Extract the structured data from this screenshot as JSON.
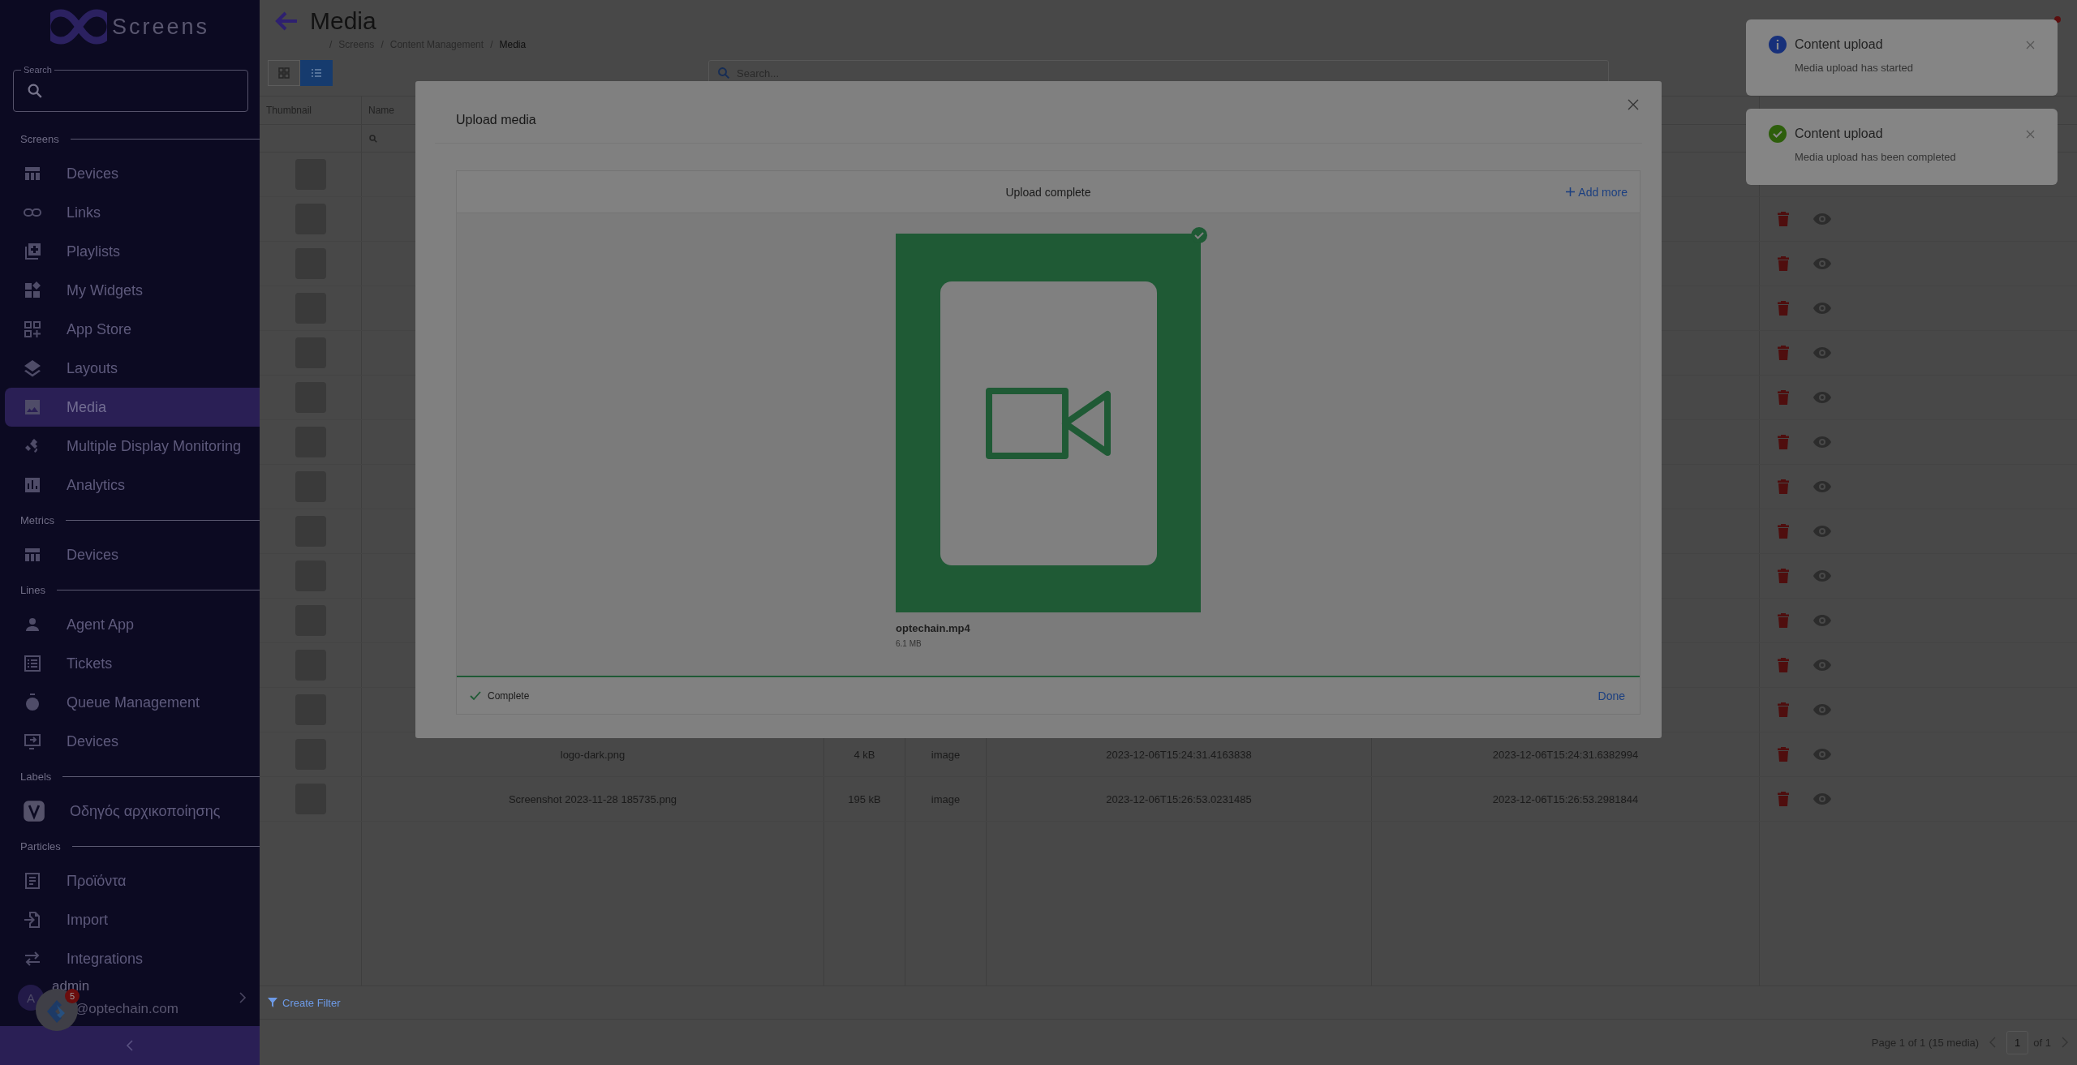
{
  "sidebar": {
    "logo": "Screens",
    "search_label": "Search",
    "sections": [
      {
        "title": "Screens",
        "items": [
          {
            "label": "Devices",
            "kind": "table",
            "selected": false
          },
          {
            "label": "Links",
            "kind": "link",
            "selected": false
          },
          {
            "label": "Playlists",
            "kind": "playlist",
            "selected": false
          },
          {
            "label": "My Widgets",
            "kind": "widgets",
            "selected": false
          },
          {
            "label": "App Store",
            "kind": "apps",
            "selected": false
          },
          {
            "label": "Layouts",
            "kind": "layers",
            "selected": false
          },
          {
            "label": "Media",
            "kind": "image",
            "selected": true
          },
          {
            "label": "Multiple Display Monitoring",
            "kind": "satellite",
            "selected": false
          },
          {
            "label": "Analytics",
            "kind": "chart",
            "selected": false
          }
        ]
      },
      {
        "title": "Metrics",
        "items": [
          {
            "label": "Devices",
            "kind": "table",
            "selected": false
          }
        ]
      },
      {
        "title": "Lines",
        "items": [
          {
            "label": "Agent App",
            "kind": "person",
            "selected": false
          },
          {
            "label": "Tickets",
            "kind": "list",
            "selected": false
          },
          {
            "label": "Queue Management",
            "kind": "timer",
            "selected": false
          },
          {
            "label": "Devices",
            "kind": "monitor",
            "selected": false
          }
        ]
      },
      {
        "title": "Labels",
        "items": [
          {
            "label": "Οδηγός αρχικοποίησης",
            "kind": "badge",
            "selected": false
          }
        ]
      },
      {
        "title": "Particles",
        "items": [
          {
            "label": "Προϊόντα",
            "kind": "article",
            "selected": false
          },
          {
            "label": "Import",
            "kind": "import",
            "selected": false
          },
          {
            "label": "Integrations",
            "kind": "swap",
            "selected": false
          }
        ]
      }
    ],
    "user": {
      "initial": "A",
      "name": "admin",
      "email": "@optechain.com"
    },
    "chat_badge": "5"
  },
  "header": {
    "title": "Media",
    "separator": "/",
    "breadcrumb": [
      {
        "label": "Screens",
        "current": false
      },
      {
        "label": "Content Management",
        "current": false
      },
      {
        "label": "Media",
        "current": true
      }
    ]
  },
  "toolbar": {
    "view_modes": [
      {
        "kind": "grid",
        "selected": false
      },
      {
        "kind": "list",
        "selected": true
      }
    ],
    "search": {
      "placeholder": "Search..."
    }
  },
  "table": {
    "columns": [
      "Thumbnail",
      "Name"
    ],
    "rows": [
      {
        "kind": "thumbnail_only"
      },
      {
        "kind": "covered"
      },
      {
        "kind": "covered"
      },
      {
        "kind": "covered"
      },
      {
        "kind": "covered"
      },
      {
        "kind": "covered"
      },
      {
        "kind": "covered"
      },
      {
        "kind": "covered"
      },
      {
        "kind": "covered"
      },
      {
        "kind": "covered"
      },
      {
        "kind": "covered"
      },
      {
        "kind": "covered"
      },
      {
        "kind": "covered"
      },
      {
        "kind": "full",
        "name": "logo-dark.png",
        "size": "4 kB",
        "media_type": "image",
        "created": "2023-12-06T15:24:31.4163838",
        "modified": "2023-12-06T15:24:31.6382994"
      },
      {
        "kind": "full",
        "name": "Screenshot 2023-11-28 185735.png",
        "size": "195 kB",
        "media_type": "image",
        "created": "2023-12-06T15:26:53.0231485",
        "modified": "2023-12-06T15:26:53.2981844"
      }
    ]
  },
  "footer": {
    "filter": "Create Filter",
    "page_info": "Page 1 of 1 (15 media)",
    "page": "1",
    "of": "of 1"
  },
  "modal": {
    "title": "Upload media",
    "status_title": "Upload complete",
    "add_more": "Add more",
    "file": {
      "name": "optechain.mp4",
      "size": "6.1 MB",
      "kind": "video",
      "done": true
    },
    "progress": {
      "level": 1
    },
    "status": "Complete",
    "done": "Done"
  },
  "toasts": [
    {
      "kind": "info",
      "title": "Content upload",
      "message": "Media upload has started"
    },
    {
      "kind": "success",
      "title": "Content upload",
      "message": "Media upload has been completed"
    }
  ]
}
